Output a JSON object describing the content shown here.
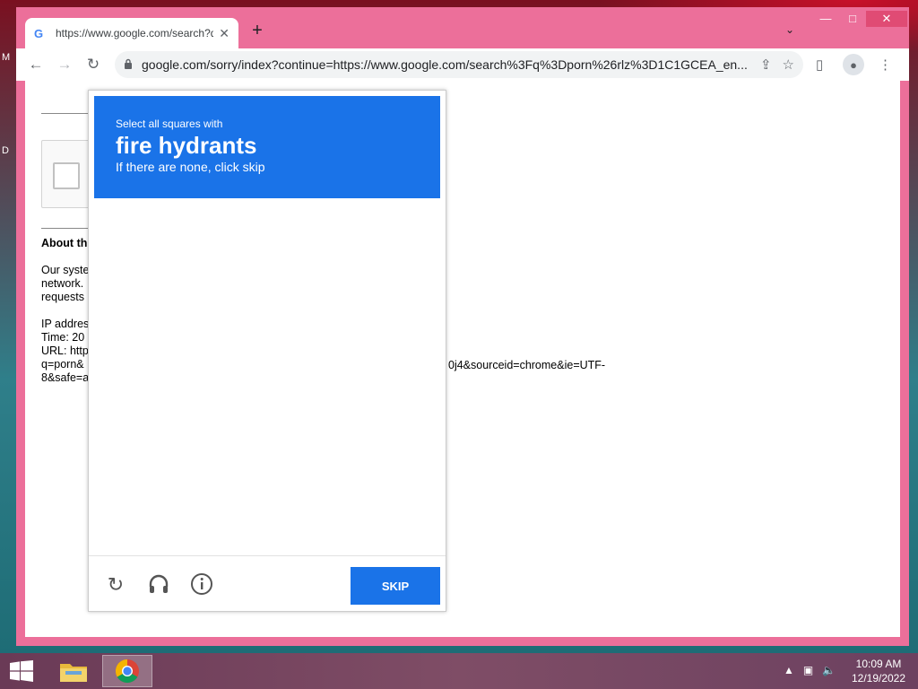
{
  "desktop": {
    "label_m": "M",
    "label_d": "D"
  },
  "window": {
    "tab_title": "https://www.google.com/search?q=",
    "tab_favicon": "G",
    "new_tab": "+",
    "tab_search_icon": "⌄",
    "minimize": "—",
    "maximize": "□",
    "close": "✕"
  },
  "toolbar": {
    "back": "←",
    "forward": "→",
    "reload": "↻",
    "url": "google.com/sorry/index?continue=https://www.google.com/search%3Fq%3Dporn%26rlz%3D1C1GCEA_en...",
    "lock": "🔒"
  },
  "page": {
    "about_heading": "About th",
    "para": [
      "Our syste",
      "network.",
      "requests"
    ],
    "info": [
      "IP addres",
      "Time: 20",
      "URL: http",
      "q=porn&",
      "8&safe=a"
    ],
    "url_tail_1": "0j4&sourceid=chrome&ie=UTF-",
    "url_tail_2": ""
  },
  "captcha": {
    "subtitle": "Select all squares with",
    "target": "fire hydrants",
    "hint": "If there are none, click skip",
    "skip_label": "SKIP",
    "grid_rows": 4,
    "grid_cols": 4
  },
  "taskbar": {
    "time": "10:09 AM",
    "date": "12/19/2022",
    "tray_arrow": "▲"
  },
  "colors": {
    "captcha_blue": "#1a73e8",
    "window_frame": "#ec6f9a"
  }
}
